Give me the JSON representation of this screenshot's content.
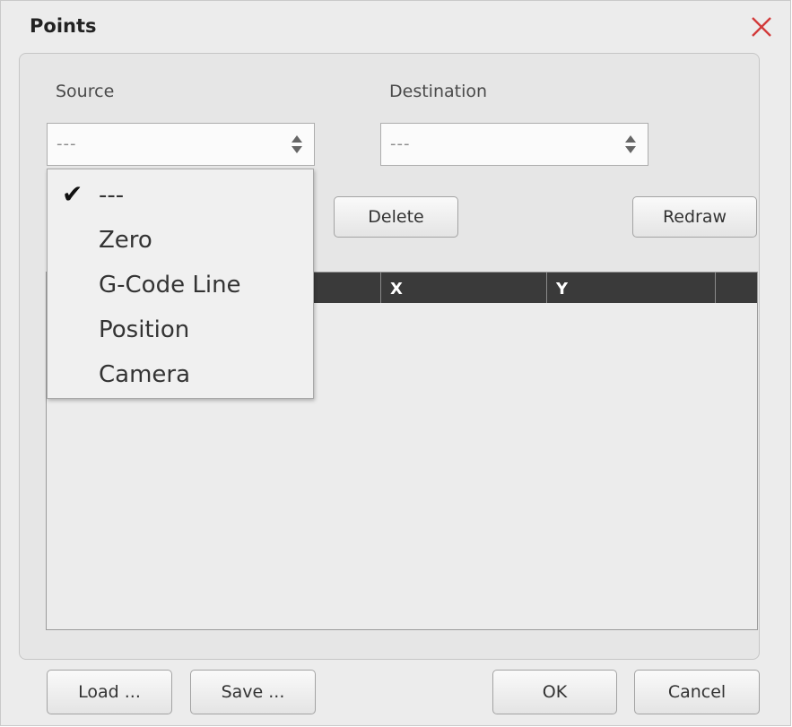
{
  "dialog": {
    "title": "Points"
  },
  "source": {
    "label": "Source",
    "value": "---",
    "options": [
      "---",
      "Zero",
      "G-Code Line",
      "Position",
      "Camera"
    ],
    "selected_index": 0
  },
  "destination": {
    "label": "Destination",
    "value": "---"
  },
  "buttons": {
    "delete": "Delete",
    "redraw": "Redraw",
    "load": "Load ...",
    "save": "Save ...",
    "ok": "OK",
    "cancel": "Cancel"
  },
  "table": {
    "columns": [
      "",
      "X",
      "Y",
      ""
    ],
    "rows": []
  },
  "icons": {
    "close": "close-icon",
    "select_arrows": "updown-arrows-icon",
    "check": "checkmark-icon"
  },
  "colors": {
    "close_icon": "#d23a3a",
    "table_header": "#3a3a3a"
  }
}
